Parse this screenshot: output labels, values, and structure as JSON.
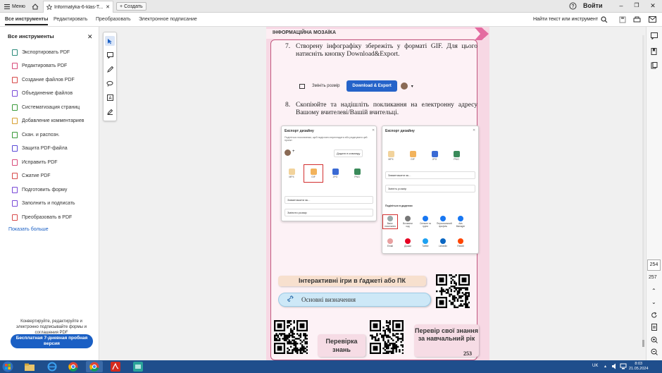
{
  "app": {
    "menu_label": "Меню",
    "tab_title": "Informatyka-6-klas-T...",
    "new_tab_label": "Создать",
    "signin_label": "Войти"
  },
  "toolbar": {
    "menu": [
      "Все инструменты",
      "Редактировать",
      "Преобразовать",
      "Электронное подписание"
    ],
    "find_label": "Найти текст или инструмент"
  },
  "left_panel": {
    "title": "Все инструменты",
    "tools": [
      {
        "label": "Экспортировать PDF",
        "color": "#2a8a7a"
      },
      {
        "label": "Редактировать PDF",
        "color": "#d84a7a"
      },
      {
        "label": "Создание файлов PDF",
        "color": "#d84a4a"
      },
      {
        "label": "Объединение файлов",
        "color": "#7a4ad8"
      },
      {
        "label": "Систематизация страниц",
        "color": "#3a9a3a"
      },
      {
        "label": "Добавление комментариев",
        "color": "#d8a030"
      },
      {
        "label": "Скан. и распозн.",
        "color": "#3a9a3a"
      },
      {
        "label": "Защита PDF-файла",
        "color": "#5a4ad8"
      },
      {
        "label": "Исправить PDF",
        "color": "#d84a7a"
      },
      {
        "label": "Сжатие PDF",
        "color": "#d84a4a"
      },
      {
        "label": "Подготовить форму",
        "color": "#7a4ad8"
      },
      {
        "label": "Заполнить и подписать",
        "color": "#7a4ad8"
      },
      {
        "label": "Преобразовать в PDF",
        "color": "#d84a4a"
      }
    ],
    "show_more": "Показать больше",
    "promo_text": "Конвертируйте, редактируйте и электронно подписывайте формы и соглашения PDF",
    "trial_button": "Бесплатная 7-дневная пробная версия"
  },
  "document": {
    "header": "ІНФОРМАЦІЙНА МОЗАЇКА",
    "step7_num": "7.",
    "step7_text": "Створену інфографіку збережіть у форматі GIF. Для цього натисніть кнопку Download&Export.",
    "cta_resize": "Змініть розмір",
    "cta_download": "Download & Export",
    "step8_num": "8.",
    "step8_text": "Скопіюйте та надішліть покликання на електронну адресу Вашому вчителеві/Вашій вчительці.",
    "screen1": {
      "title": "Експорт дизайну",
      "subtitle": "Поділіться посиланням, щоб надіслати переглядати або редагувати цей проект",
      "team": "Додати в команду",
      "formats": [
        "MP4",
        "GIF",
        "JPG",
        "PNG"
      ],
      "row1": "Завантажити як...",
      "row2": "Змінити розмір"
    },
    "screen2": {
      "title": "Експорт дизайну",
      "formats": [
        "MP4",
        "GIF",
        "JPG",
        "PNG"
      ],
      "row1": "Завантажити як...",
      "row2": "Змініть розмір",
      "share_title": "Поділіться в додатках",
      "apps_row1": [
        "Вміст. посилання",
        "Вставити код",
        "Спільне та групи",
        "Персональний профіль",
        "Ads Manager"
      ],
      "apps_row2": [
        "Email",
        "Дошки",
        "Twitter",
        "LinkedIn",
        "Reddit"
      ]
    },
    "pill1": "Інтерактивні ігри в ґаджеті або ПК",
    "pill2": "Основні визначення",
    "pill3": "Перевірка знань",
    "pill4": "Перевір свої знання за навчальний рік",
    "page_number": "253"
  },
  "viewer": {
    "current_page": "254",
    "total_pages": "257"
  },
  "taskbar": {
    "lang": "UK",
    "time": "8:03",
    "date": "21.05.2024"
  }
}
